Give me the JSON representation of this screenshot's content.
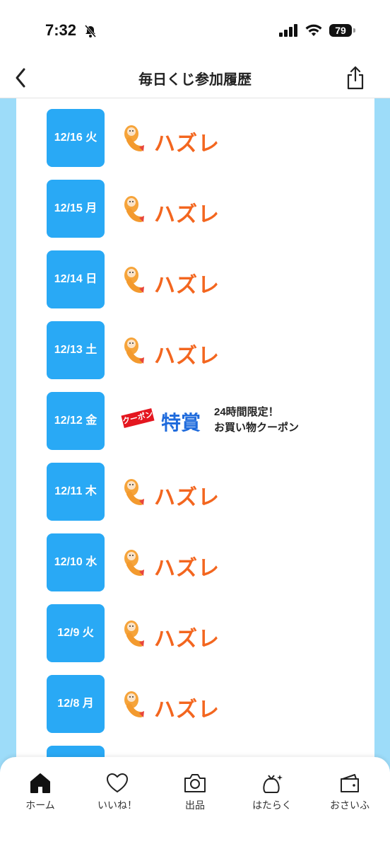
{
  "status": {
    "time": "7:32",
    "battery": "79"
  },
  "nav": {
    "title": "毎日くじ参加履歴"
  },
  "history": [
    {
      "date": "12/16 火",
      "result": "ハズレ"
    },
    {
      "date": "12/15 月",
      "result": "ハズレ"
    },
    {
      "date": "12/14 日",
      "result": "ハズレ"
    },
    {
      "date": "12/13 土",
      "result": "ハズレ"
    },
    {
      "date": "12/12 金",
      "result": "特賞",
      "tag": "クーポン",
      "desc_line1": "24時間限定！",
      "desc_line2": "お買い物クーポン"
    },
    {
      "date": "12/11 木",
      "result": "ハズレ"
    },
    {
      "date": "12/10 水",
      "result": "ハズレ"
    },
    {
      "date": "12/9 火",
      "result": "ハズレ"
    },
    {
      "date": "12/8 月",
      "result": "ハズレ"
    }
  ],
  "tabs": [
    {
      "label": "ホーム",
      "icon": "home-icon"
    },
    {
      "label": "いいね！",
      "icon": "heart-icon"
    },
    {
      "label": "出品",
      "icon": "camera-icon"
    },
    {
      "label": "はたらく",
      "icon": "money-bag-icon"
    },
    {
      "label": "おさいふ",
      "icon": "wallet-icon"
    }
  ],
  "colors": {
    "accent": "#29a9f5",
    "hazure": "#f3661f",
    "special": "#1f6bdc",
    "coupon_tag": "#e4161f",
    "side_bg": "#9ddcf9"
  }
}
